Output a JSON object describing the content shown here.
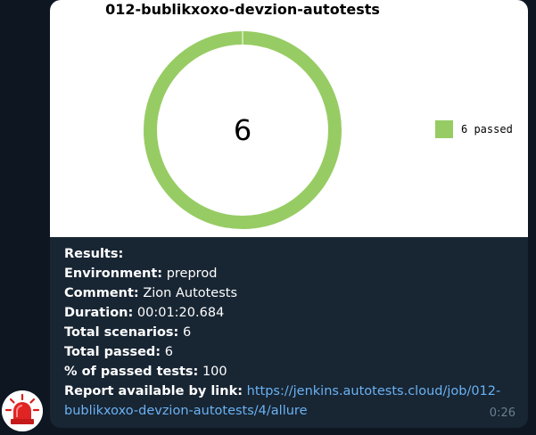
{
  "chart": {
    "title": "012-bublikxoxo-devzion-autotests",
    "center_value": "6",
    "legend_label": "6 passed",
    "color": "#97cc64"
  },
  "chart_data": {
    "type": "pie",
    "title": "012-bublikxoxo-devzion-autotests",
    "categories": [
      "passed"
    ],
    "values": [
      6
    ],
    "legend": [
      "6 passed"
    ],
    "center_label": "6",
    "colors": [
      "#97cc64"
    ],
    "legend_position": "right"
  },
  "message": {
    "results_label": "Results:",
    "environment_label": "Environment:",
    "environment_value": " preprod",
    "comment_label": "Comment:",
    "comment_value": " Zion Autotests",
    "duration_label": "Duration:",
    "duration_value": " 00:01:20.684",
    "total_scenarios_label": "Total scenarios:",
    "total_scenarios_value": " 6",
    "total_passed_label": "Total passed:",
    "total_passed_value": " 6",
    "percent_passed_label": "% of passed tests:",
    "percent_passed_value": " 100",
    "report_label": "Report available by link:",
    "report_link": "https://jenkins.autotests.cloud/job/012-bublikxoxo-devzion-autotests/4/allure",
    "time": "0:26"
  },
  "avatar": {
    "icon": "siren-icon"
  },
  "colors": {
    "background": "#0e1621",
    "bubble": "#182533",
    "link": "#6ab2f2",
    "passed": "#97cc64"
  }
}
